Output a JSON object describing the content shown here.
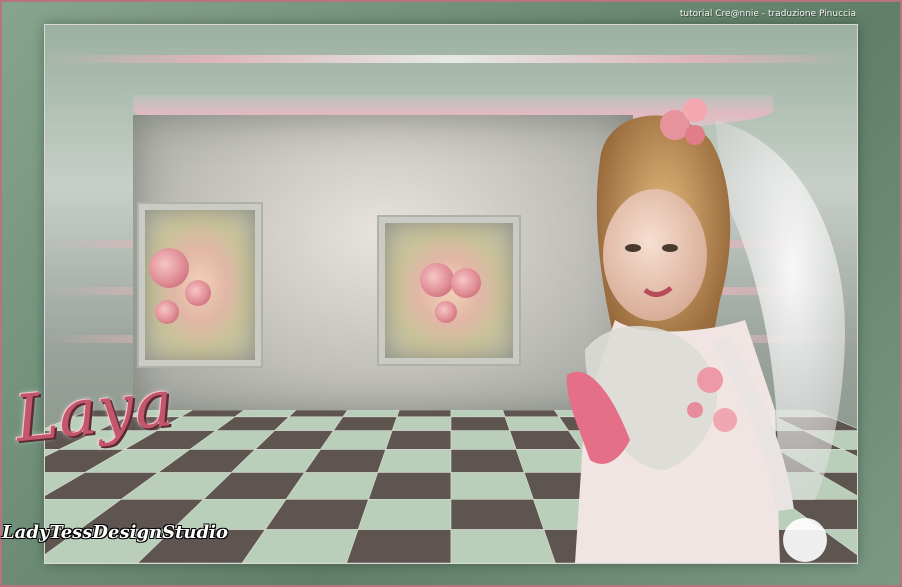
{
  "credit_text": "tutorial Cre@nnie - traduzione Pinuccia",
  "title_text": "Laya",
  "signature_text": "LadyTessDesignStudio",
  "colors": {
    "frame": "#6f8f78",
    "border_accent": "#b8747e",
    "title": "#c4566b",
    "floor_light": "#b9cfb9",
    "floor_dark": "#5e5450"
  }
}
